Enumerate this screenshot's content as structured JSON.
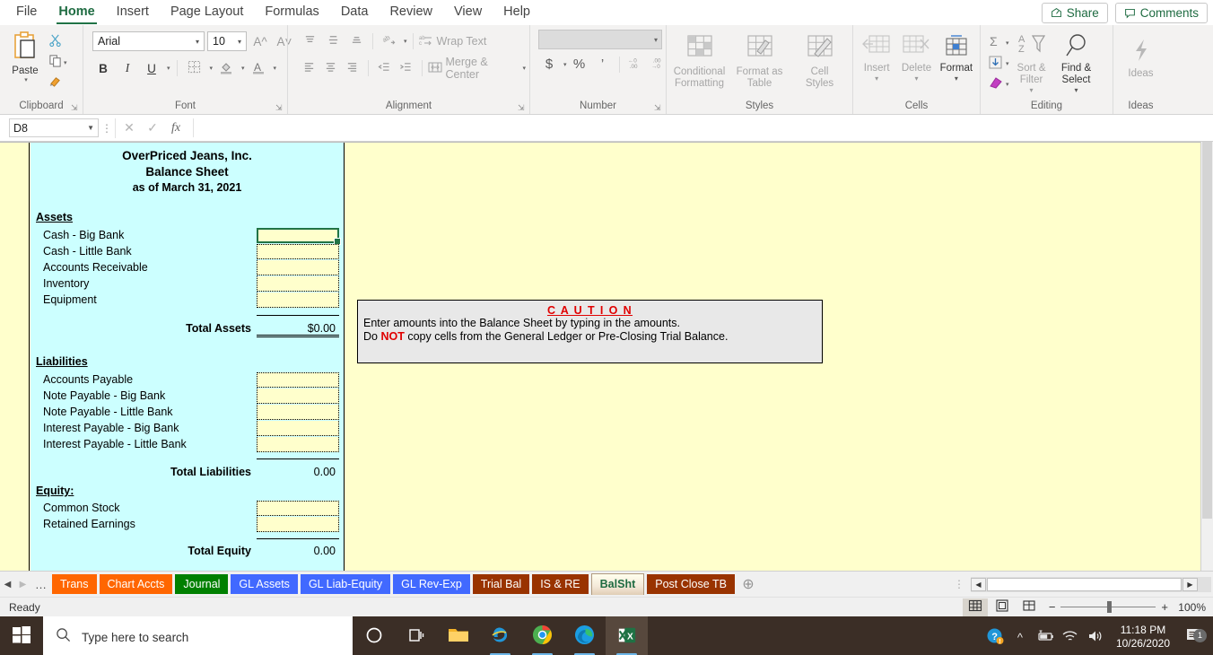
{
  "ribbon": {
    "tabs": [
      {
        "label": "File",
        "active": false
      },
      {
        "label": "Home",
        "active": true
      },
      {
        "label": "Insert",
        "active": false
      },
      {
        "label": "Page Layout",
        "active": false
      },
      {
        "label": "Formulas",
        "active": false
      },
      {
        "label": "Data",
        "active": false
      },
      {
        "label": "Review",
        "active": false
      },
      {
        "label": "View",
        "active": false
      },
      {
        "label": "Help",
        "active": false
      }
    ],
    "share_label": "Share",
    "comments_label": "Comments",
    "groups": {
      "clipboard": {
        "label": "Clipboard",
        "paste_label": "Paste",
        "cut_icon": "scissors-icon",
        "copy_icon": "copy-icon",
        "format_painter_icon": "format-painter-icon"
      },
      "font": {
        "label": "Font",
        "font_name": "Arial",
        "font_size": "10",
        "grow_font_icon": "grow-font-icon",
        "shrink_font_icon": "shrink-font-icon",
        "bold_label": "B",
        "italic_label": "I",
        "underline_label": "U",
        "borders_icon": "borders-icon",
        "fill_color_icon": "fill-color-icon",
        "font_color_label": "A"
      },
      "alignment": {
        "label": "Alignment",
        "wrap_text_label": "Wrap Text",
        "merge_center_label": "Merge & Center",
        "orientation_icon": "orientation-icon"
      },
      "number": {
        "label": "Number",
        "format_value": "",
        "currency_label": "$",
        "percent_label": "%",
        "comma_label": "’",
        "increase_decimal_icon": "increase-decimal-icon",
        "decrease_decimal_icon": "decrease-decimal-icon"
      },
      "styles": {
        "label": "Styles",
        "items": [
          {
            "line1": "Conditional",
            "line2": "Formatting"
          },
          {
            "line1": "Format as",
            "line2": "Table"
          },
          {
            "line1": "Cell",
            "line2": "Styles"
          }
        ]
      },
      "cells": {
        "label": "Cells",
        "items": [
          {
            "line1": "Insert"
          },
          {
            "line1": "Delete"
          },
          {
            "line1": "Format"
          }
        ]
      },
      "editing": {
        "label": "Editing",
        "autosum_icon": "autosum-icon",
        "fill_icon": "fill-down-icon",
        "clear_icon": "clear-icon",
        "sort_filter_l1": "Sort &",
        "sort_filter_l2": "Filter",
        "find_select_l1": "Find &",
        "find_select_l2": "Select"
      },
      "ideas": {
        "label": "Ideas",
        "button_label": "Ideas"
      }
    }
  },
  "formula_bar": {
    "name_box": "D8",
    "cancel_icon": "cancel-icon",
    "enter_icon": "confirm-icon",
    "function_icon": "insert-function-icon",
    "formula_value": "",
    "formula_placeholder": ""
  },
  "worksheet": {
    "balance_sheet": {
      "company": "OverPriced Jeans, Inc.",
      "statement": "Balance Sheet",
      "as_of": "as of March 31, 2021",
      "assets_heading": "Assets",
      "assets_rows": [
        "Cash - Big Bank",
        "Cash - Little Bank",
        "Accounts Receivable",
        "Inventory",
        "Equipment"
      ],
      "total_assets_label": "Total Assets",
      "total_assets_value": "$0.00",
      "liabilities_heading": "Liabilities",
      "liabilities_rows": [
        "Accounts Payable",
        "Note Payable - Big Bank",
        "Note Payable - Little Bank",
        "Interest Payable - Big Bank",
        "Interest Payable - Little Bank"
      ],
      "total_liabilities_label": "Total Liabilities",
      "total_liabilities_value": "0.00",
      "equity_heading": "Equity:",
      "equity_rows": [
        "Common Stock",
        "Retained Earnings"
      ],
      "total_equity_label": "Total Equity",
      "total_equity_value": "0.00"
    },
    "caution": {
      "title": "C A U T I O N",
      "line1": "Enter amounts into the Balance Sheet by typing in the amounts.",
      "line2_pre": "Do ",
      "line2_emph": "NOT",
      "line2_post": " copy cells from the General Ledger or Pre-Closing Trial Balance."
    },
    "selected_cell": "D8"
  },
  "sheet_tabs": {
    "prev_icon": "nav-prev-icon",
    "next_icon": "nav-next-icon",
    "more_icon": "nav-more-icon",
    "add_icon": "add-sheet-icon",
    "tabs": [
      {
        "label": "Trans",
        "color": "#FF6600",
        "text": "#FFFFFF",
        "active": false
      },
      {
        "label": "Chart Accts",
        "color": "#FF6600",
        "text": "#FFFFFF",
        "active": false
      },
      {
        "label": "Journal",
        "color": "#008000",
        "text": "#FFFFFF",
        "active": false
      },
      {
        "label": "GL Assets",
        "color": "#4169FF",
        "text": "#FFFFFF",
        "active": false
      },
      {
        "label": "GL Liab-Equity",
        "color": "#4169FF",
        "text": "#FFFFFF",
        "active": false
      },
      {
        "label": "GL Rev-Exp",
        "color": "#4169FF",
        "text": "#FFFFFF",
        "active": false
      },
      {
        "label": "Trial Bal",
        "color": "#993300",
        "text": "#FFFFFF",
        "active": false
      },
      {
        "label": "IS & RE",
        "color": "#993300",
        "text": "#FFFFFF",
        "active": false
      },
      {
        "label": "BalSht",
        "color": "#F2E6D2",
        "text": "#1E6B41",
        "active": true
      },
      {
        "label": "Post Close TB",
        "color": "#993300",
        "text": "#FFFFFF",
        "active": false
      }
    ]
  },
  "status_bar": {
    "status": "Ready",
    "normal_view_icon": "normal-view-icon",
    "page_layout_icon": "page-layout-icon",
    "page_break_icon": "page-break-preview-icon",
    "zoom_out_label": "−",
    "zoom_in_label": "+",
    "zoom_value": "100%"
  },
  "taskbar": {
    "start_icon": "windows-start-icon",
    "search_icon": "search-icon",
    "search_placeholder": "Type here to search",
    "cortana_icon": "cortana-icon",
    "task_view_icon": "task-view-icon",
    "file_explorer_icon": "file-explorer-icon",
    "ie_icon": "internet-explorer-icon",
    "chrome_icon": "chrome-icon",
    "edge_icon": "edge-icon",
    "excel_icon": "excel-icon",
    "help_icon": "help-circle-icon",
    "chevron_up_icon": "show-hidden-icons-icon",
    "battery_icon": "battery-icon",
    "wifi_icon": "wifi-icon",
    "volume_icon": "volume-icon",
    "time": "11:18 PM",
    "date": "10/26/2020",
    "notification_icon": "notifications-icon",
    "notification_count": "1"
  }
}
